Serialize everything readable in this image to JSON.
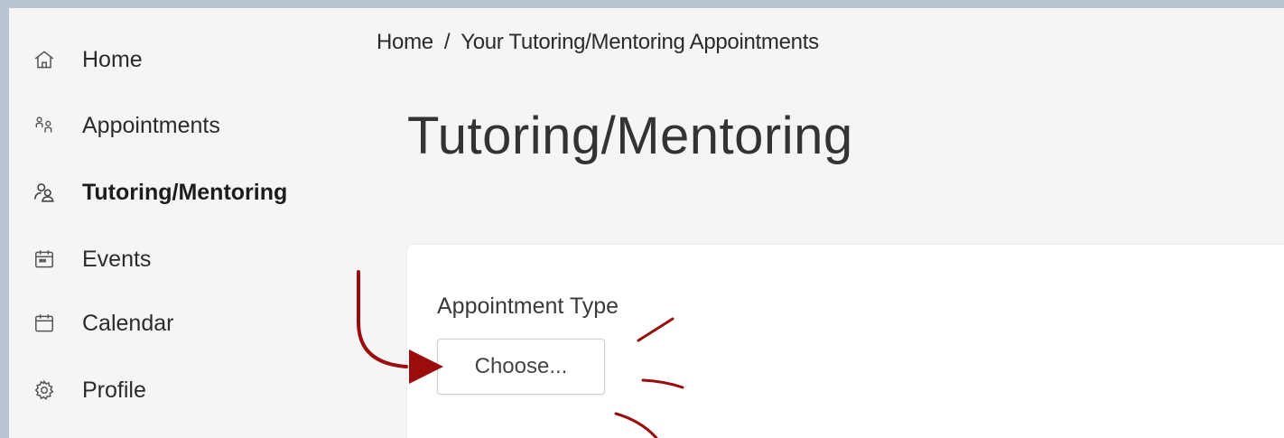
{
  "sidebar": {
    "items": [
      {
        "label": "Home",
        "icon": "home-icon"
      },
      {
        "label": "Appointments",
        "icon": "people-icon"
      },
      {
        "label": "Tutoring/Mentoring",
        "icon": "mentoring-icon",
        "active": true
      },
      {
        "label": "Events",
        "icon": "event-calendar-icon"
      },
      {
        "label": "Calendar",
        "icon": "calendar-icon"
      },
      {
        "label": "Profile",
        "icon": "gear-icon"
      }
    ]
  },
  "breadcrumb": {
    "home": "Home",
    "separator": "/",
    "current": "Your Tutoring/Mentoring Appointments"
  },
  "page": {
    "title": "Tutoring/Mentoring"
  },
  "form": {
    "appointment_type_label": "Appointment Type",
    "choose_button": "Choose..."
  },
  "colors": {
    "page_background": "#b9c4d1",
    "content_background": "#f5f5f5",
    "card_background": "#ffffff",
    "annotation_red": "#9b0d0d"
  }
}
